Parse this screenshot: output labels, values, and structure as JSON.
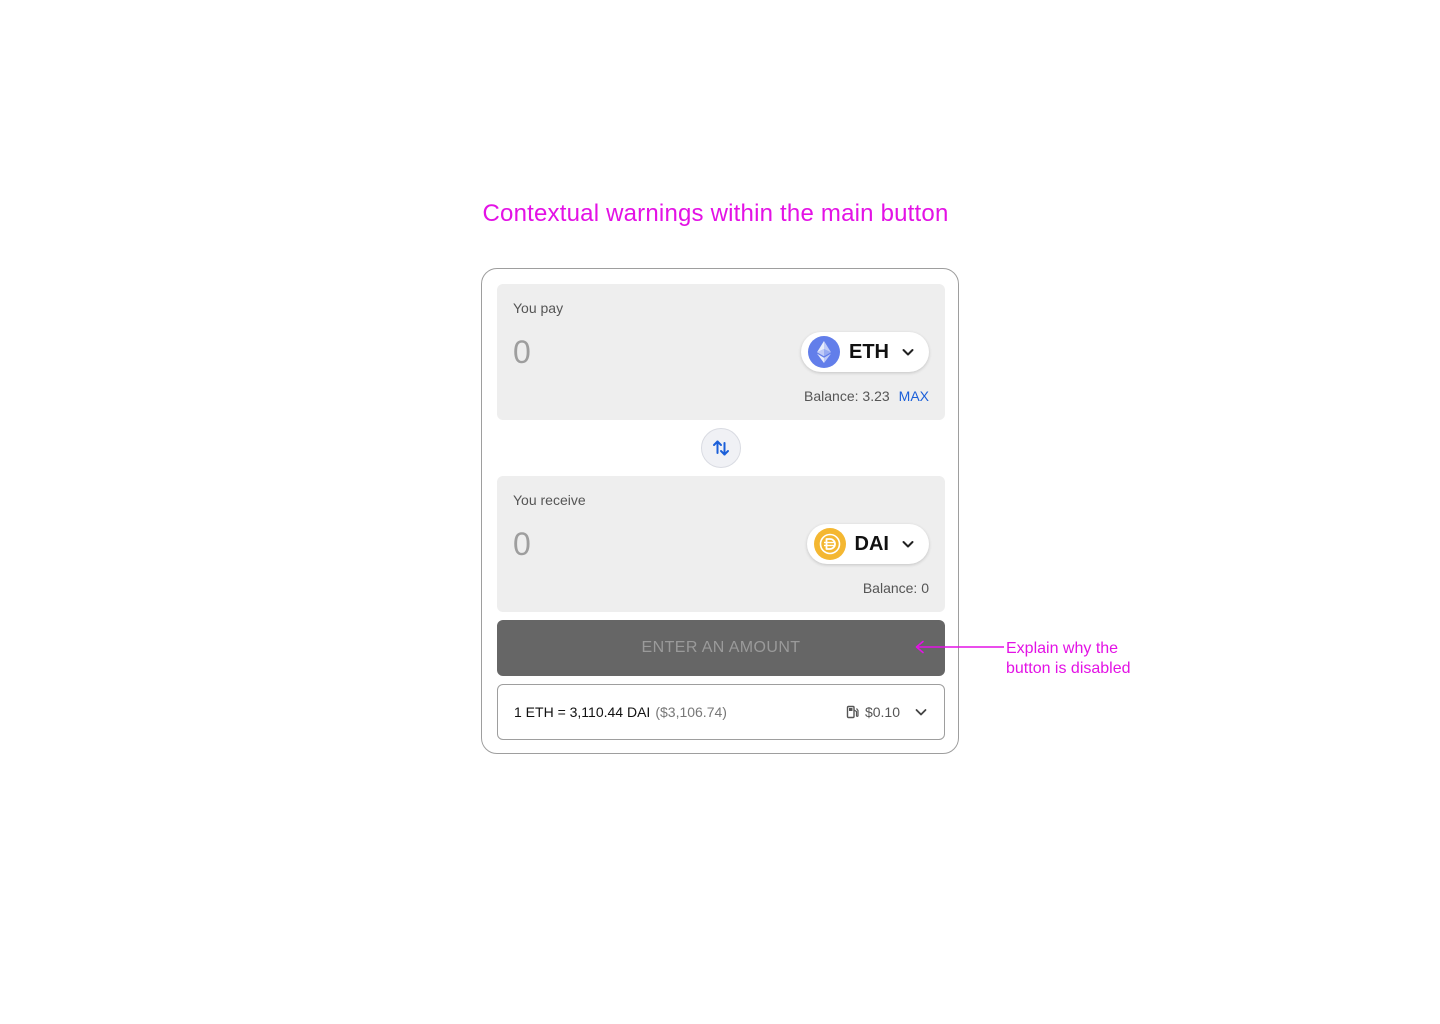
{
  "heading": "Contextual warnings within the main button",
  "pay": {
    "label": "You pay",
    "amount": "0",
    "token": "ETH",
    "balance": "Balance: 3.23",
    "max_label": "MAX"
  },
  "receive": {
    "label": "You receive",
    "amount": "0",
    "token": "DAI",
    "balance": "Balance: 0"
  },
  "main_button": {
    "label": "ENTER AN AMOUNT",
    "disabled": true
  },
  "rate": {
    "text": "1 ETH = 3,110.44 DAI",
    "usd": "($3,106.74)",
    "gas": "$0.10"
  },
  "annotation": {
    "line1": "Explain why the",
    "line2": "button is disabled"
  },
  "icons": {
    "eth": "ethereum-icon",
    "dai": "dai-icon",
    "swap": "swap-arrows-icon",
    "chevron": "chevron-down-icon",
    "gas": "gas-pump-icon"
  },
  "colors": {
    "annotation": "#e312e5",
    "accent": "#1b5fd9",
    "eth": "#627eea",
    "dai": "#f4b731",
    "disabled_button": "#666666"
  }
}
